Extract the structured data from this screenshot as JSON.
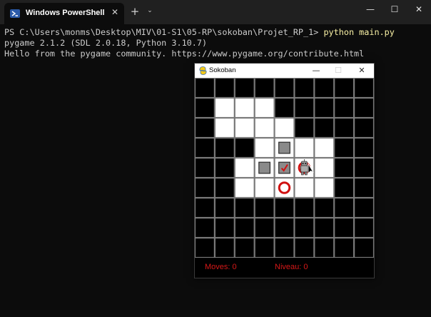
{
  "terminal": {
    "tab_title": "Windows PowerShell",
    "new_tab": "+",
    "dropdown": "⌄",
    "close_tab": "✕",
    "window_buttons": {
      "minimize": "—",
      "maximize": "☐",
      "close": "✕"
    },
    "lines": [
      {
        "prompt": "PS C:\\Users\\monms\\Desktop\\MIV\\01-S1\\05-RP\\sokoban\\Projet_RP_1> ",
        "command": "python main.py"
      },
      {
        "text": "pygame 2.1.2 (SDL 2.0.18, Python 3.10.7)"
      },
      {
        "text": "Hello from the pygame community. https://www.pygame.org/contribute.html"
      }
    ]
  },
  "sokoban": {
    "title": "Sokoban",
    "window_buttons": {
      "minimize": "—",
      "maximize": "☐",
      "close": "✕"
    },
    "moves_label": "Moves: 0",
    "level_label": "Niveau: 0",
    "status_color": "#d81818",
    "map": [
      "WWWWWWWWW",
      "WFFFWWWWW",
      "WFFFFWWWW",
      "WWWFBFFWW",
      "WWFBKGFWW",
      "WWFFTFFWW",
      "WWWWWWWWW",
      "WWWWWWWWW",
      "WWWWWWWWW"
    ],
    "legend": {
      "W": "wall",
      "F": "floor",
      "B": "box",
      "K": "box-on-target",
      "T": "target",
      "G": "player-on-target"
    }
  }
}
